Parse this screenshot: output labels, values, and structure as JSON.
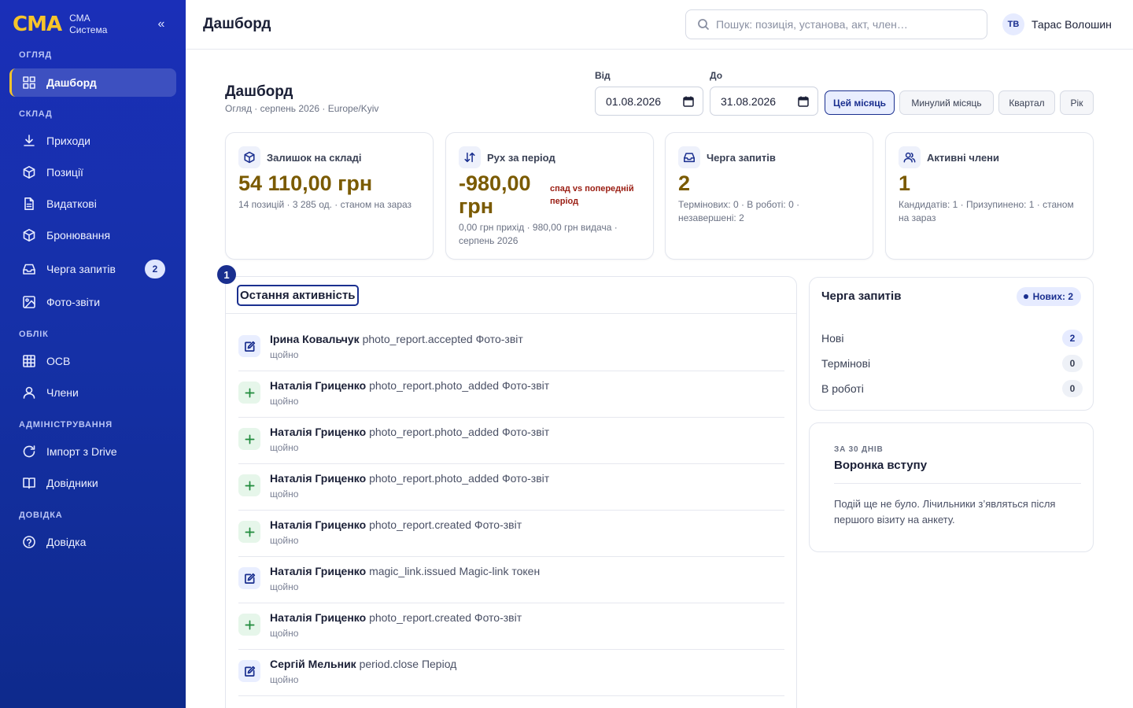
{
  "app": {
    "logo": "СМА",
    "name_line1": "СМА",
    "name_line2": "Система",
    "collapse_glyph": "«"
  },
  "sidebar": {
    "sections": {
      "overview": "ОГЛЯД",
      "warehouse": "СКЛАД",
      "accounting": "ОБЛІК",
      "admin": "АДМІНІСТРУВАННЯ",
      "help": "ДОВІДКА"
    },
    "items": [
      {
        "label": "Дашборд",
        "icon": "dashboard-grid-icon"
      },
      {
        "label": "Приходи",
        "icon": "download-icon"
      },
      {
        "label": "Позиції",
        "icon": "box-icon"
      },
      {
        "label": "Видаткові",
        "icon": "document-icon"
      },
      {
        "label": "Бронювання",
        "icon": "box-icon"
      },
      {
        "label": "Черга запитів",
        "icon": "inbox-icon",
        "badge": "2"
      },
      {
        "label": "Фото-звіти",
        "icon": "image-icon"
      },
      {
        "label": "ОСВ",
        "icon": "table-icon"
      },
      {
        "label": "Члени",
        "icon": "user-icon"
      },
      {
        "label": "Імпорт з Drive",
        "icon": "refresh-icon"
      },
      {
        "label": "Довідники",
        "icon": "book-icon"
      },
      {
        "label": "Довідка",
        "icon": "help-circle-icon"
      }
    ]
  },
  "topbar": {
    "title": "Дашборд",
    "search_placeholder": "Пошук: позиція, установа, акт, член…",
    "user_initials": "ТВ",
    "user_name": "Тарас Волошин"
  },
  "page": {
    "title": "Дашборд",
    "subtitle": "Огляд · серпень 2026 · Europe/Kyiv"
  },
  "filters": {
    "from_label": "Від",
    "from_value": "01.08.2026",
    "to_label": "До",
    "to_value": "31.08.2026",
    "periods": [
      "Цей місяць",
      "Минулий місяць",
      "Квартал",
      "Рік"
    ],
    "active_period": "Цей місяць"
  },
  "kpis": [
    {
      "label": "Залишок на складі",
      "icon": "box-icon",
      "value": "54 110,00 грн",
      "note": "14 позицій · 3 285 од. · станом на зараз"
    },
    {
      "label": "Рух за період",
      "icon": "arrows-updown-icon",
      "value_line1": "-980,00",
      "value_line2": "грн",
      "warning": "спад vs попередній період",
      "note": "0,00 грн прихід · 980,00 грн видача · серпень 2026"
    },
    {
      "label": "Черга запитів",
      "icon": "inbox-icon",
      "value": "2",
      "note": "Термінових: 0 · В роботі: 0 · незавершені: 2"
    },
    {
      "label": "Активні члени",
      "icon": "users-icon",
      "value": "1",
      "note": "Кандидатів: 1 · Призупинено: 1 · станом на зараз"
    }
  ],
  "activity": {
    "step_number": "1",
    "title": "Остання активність",
    "items": [
      {
        "icon": "edit-icon",
        "kind": "edit",
        "actor": "Ірина Ковальчук",
        "action": "photo_report.accepted Фото-звіт",
        "time": "щойно"
      },
      {
        "icon": "plus-icon",
        "kind": "add",
        "actor": "Наталія Гриценко",
        "action": "photo_report.photo_added Фото-звіт",
        "time": "щойно"
      },
      {
        "icon": "plus-icon",
        "kind": "add",
        "actor": "Наталія Гриценко",
        "action": "photo_report.photo_added Фото-звіт",
        "time": "щойно"
      },
      {
        "icon": "plus-icon",
        "kind": "add",
        "actor": "Наталія Гриценко",
        "action": "photo_report.photo_added Фото-звіт",
        "time": "щойно"
      },
      {
        "icon": "plus-icon",
        "kind": "add",
        "actor": "Наталія Гриценко",
        "action": "photo_report.created Фото-звіт",
        "time": "щойно"
      },
      {
        "icon": "edit-icon",
        "kind": "edit",
        "actor": "Наталія Гриценко",
        "action": "magic_link.issued Magic-link токен",
        "time": "щойно"
      },
      {
        "icon": "plus-icon",
        "kind": "add",
        "actor": "Наталія Гриценко",
        "action": "photo_report.created Фото-звіт",
        "time": "щойно"
      },
      {
        "icon": "edit-icon",
        "kind": "edit",
        "actor": "Сергій Мельник",
        "action": "period.close Період",
        "time": "щойно"
      }
    ]
  },
  "queue": {
    "title": "Черга запитів",
    "new_pill": "Нових: 2",
    "rows": [
      {
        "label": "Нові",
        "count": "2"
      },
      {
        "label": "Термінові",
        "count": "0"
      },
      {
        "label": "В роботі",
        "count": "0"
      }
    ]
  },
  "funnel": {
    "kicker": "ЗА 30 ДНІВ",
    "title": "Воронка вступу",
    "text": "Подій ще не було. Лічильники з’являться після першого візиту на анкету."
  },
  "colors": {
    "sidebar": "#1a2fb8",
    "accent": "#1a2f8f",
    "brand_yellow": "#f6c42b",
    "kpi_value": "#7a5a00",
    "warning": "#9a1d12",
    "add_green": "#1f8a3b"
  }
}
